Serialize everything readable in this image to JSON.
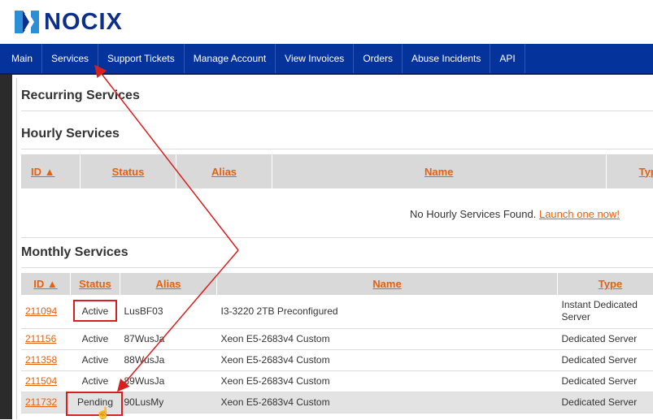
{
  "brand": {
    "name": "NOCIX",
    "accent": "#05339c",
    "link_color": "#e8600c"
  },
  "nav": {
    "items": [
      {
        "label": "Main"
      },
      {
        "label": "Services"
      },
      {
        "label": "Support Tickets"
      },
      {
        "label": "Manage Account"
      },
      {
        "label": "View Invoices"
      },
      {
        "label": "Orders"
      },
      {
        "label": "Abuse Incidents"
      },
      {
        "label": "API"
      }
    ]
  },
  "page": {
    "title": "Recurring Services"
  },
  "hourly": {
    "title": "Hourly Services",
    "columns": {
      "id": "ID ▲",
      "status": "Status",
      "alias": "Alias",
      "name": "Name",
      "type": "Type"
    },
    "empty_message": "No Hourly Services Found.",
    "empty_link": "Launch one now!"
  },
  "monthly": {
    "title": "Monthly Services",
    "columns": {
      "id": "ID ▲",
      "status": "Status",
      "alias": "Alias",
      "name": "Name",
      "type": "Type"
    },
    "rows": [
      {
        "id": "211094",
        "status": "Active",
        "alias": "LusBF03",
        "name": "I3-3220 2TB Preconfigured",
        "type": "Instant Dedicated Server"
      },
      {
        "id": "211156",
        "status": "Active",
        "alias": "87WusJa",
        "name": "Xeon E5-2683v4 Custom",
        "type": "Dedicated Server"
      },
      {
        "id": "211358",
        "status": "Active",
        "alias": "88WusJa",
        "name": "Xeon E5-2683v4 Custom",
        "type": "Dedicated Server"
      },
      {
        "id": "211504",
        "status": "Active",
        "alias": "89WusJa",
        "name": "Xeon E5-2683v4 Custom",
        "type": "Dedicated Server"
      },
      {
        "id": "211732",
        "status": "Pending",
        "alias": "90LusMy",
        "name": "Xeon E5-2683v4 Custom",
        "type": "Dedicated Server"
      }
    ]
  },
  "annotation_color": "#d62020"
}
